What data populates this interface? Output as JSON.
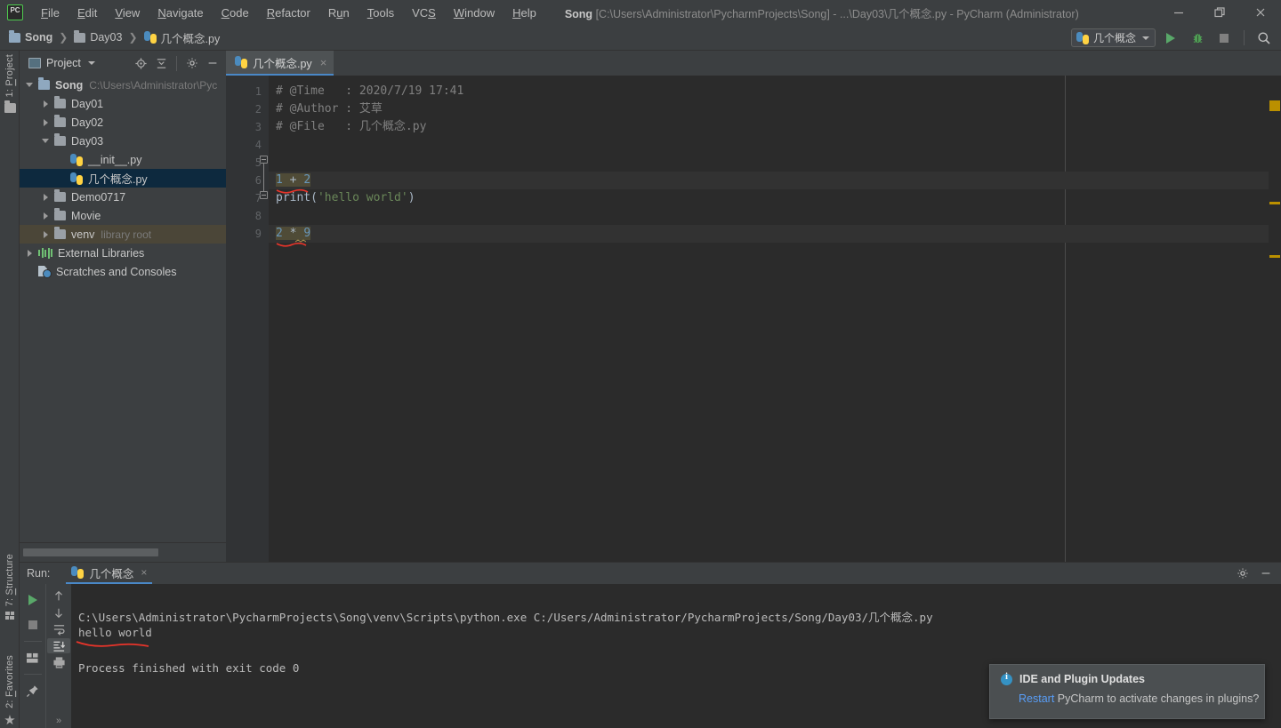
{
  "window": {
    "logo": "pycharm-logo",
    "title_project": "Song",
    "title_rest": "[C:\\Users\\Administrator\\PycharmProjects\\Song] - ...\\Day03\\几个概念.py - PyCharm (Administrator)",
    "minimize": "minimize-icon",
    "maximize": "maximize-icon",
    "close": "close-icon"
  },
  "menu": {
    "items": [
      {
        "pre": "",
        "mn": "F",
        "post": "ile"
      },
      {
        "pre": "",
        "mn": "E",
        "post": "dit"
      },
      {
        "pre": "",
        "mn": "V",
        "post": "iew"
      },
      {
        "pre": "",
        "mn": "N",
        "post": "avigate"
      },
      {
        "pre": "",
        "mn": "C",
        "post": "ode"
      },
      {
        "pre": "",
        "mn": "R",
        "post": "efactor"
      },
      {
        "pre": "R",
        "mn": "u",
        "post": "n"
      },
      {
        "pre": "",
        "mn": "T",
        "post": "ools"
      },
      {
        "pre": "VC",
        "mn": "S",
        "post": ""
      },
      {
        "pre": "",
        "mn": "W",
        "post": "indow"
      },
      {
        "pre": "",
        "mn": "H",
        "post": "elp"
      }
    ]
  },
  "breadcrumb": {
    "items": [
      "Song",
      "Day03",
      "几个概念.py"
    ],
    "separator": "❯"
  },
  "toolbar": {
    "run_config_label": "几个概念",
    "run_button": "run-icon",
    "debug_button": "debug-icon",
    "stop_button": "stop-icon",
    "search_button": "search-icon"
  },
  "left_strip": {
    "project_tab": {
      "num": "1: ",
      "mn": "P",
      "rest": "roject"
    },
    "structure_tab": {
      "num": "7: ",
      "mn": "S",
      "rest": "tructure"
    },
    "favorites_tab": {
      "num": "2: ",
      "mn": "F",
      "rest": "avorites"
    }
  },
  "project_panel": {
    "title": "Project",
    "header_icons": [
      "locate-icon",
      "collapse-all-icon",
      "gear-icon",
      "hide-icon"
    ],
    "tree": [
      {
        "indent": 0,
        "twisty": "down",
        "icon": "folder-blue",
        "label": "Song",
        "bold": true,
        "sub": "C:\\Users\\Administrator\\Pyc",
        "state": "normal"
      },
      {
        "indent": 1,
        "twisty": "right",
        "icon": "folder-dark",
        "label": "Day01",
        "bold": false,
        "sub": "",
        "state": "normal"
      },
      {
        "indent": 1,
        "twisty": "right",
        "icon": "folder-dark",
        "label": "Day02",
        "bold": false,
        "sub": "",
        "state": "normal"
      },
      {
        "indent": 1,
        "twisty": "down",
        "icon": "folder-dark",
        "label": "Day03",
        "bold": false,
        "sub": "",
        "state": "normal"
      },
      {
        "indent": 2,
        "twisty": "none",
        "icon": "python-file",
        "label": "__init__.py",
        "bold": false,
        "sub": "",
        "state": "normal"
      },
      {
        "indent": 2,
        "twisty": "none",
        "icon": "python-file",
        "label": "几个概念.py",
        "bold": false,
        "sub": "",
        "state": "selected"
      },
      {
        "indent": 1,
        "twisty": "right",
        "icon": "folder-dark",
        "label": "Demo0717",
        "bold": false,
        "sub": "",
        "state": "normal"
      },
      {
        "indent": 1,
        "twisty": "right",
        "icon": "folder-dark",
        "label": "Movie",
        "bold": false,
        "sub": "",
        "state": "normal"
      },
      {
        "indent": 1,
        "twisty": "right",
        "icon": "folder-dark",
        "label": "venv",
        "bold": false,
        "sub": "library root",
        "state": "venv"
      },
      {
        "indent": 0,
        "twisty": "right",
        "icon": "libraries",
        "label": "External Libraries",
        "bold": false,
        "sub": "",
        "state": "normal"
      },
      {
        "indent": 0,
        "twisty": "none",
        "icon": "scratches",
        "label": "Scratches and Consoles",
        "bold": false,
        "sub": "",
        "state": "normal"
      }
    ]
  },
  "editor": {
    "tab": {
      "label": "几个概念.py",
      "icon": "python-file",
      "close": "×"
    },
    "lines": [
      {
        "n": "1",
        "tokens": [
          {
            "t": "# @Time   : 2020/7/19 17:41",
            "c": "cmt"
          }
        ]
      },
      {
        "n": "2",
        "tokens": [
          {
            "t": "# @Author : 艾草",
            "c": "cmt"
          }
        ]
      },
      {
        "n": "3",
        "tokens": [
          {
            "t": "# @File   : 几个概念.py",
            "c": "cmt"
          }
        ]
      },
      {
        "n": "4",
        "tokens": []
      },
      {
        "n": "5",
        "tokens": []
      },
      {
        "n": "6",
        "tokens": [
          {
            "t": "1",
            "c": "num hl"
          },
          {
            "t": " + ",
            "c": "op hl"
          },
          {
            "t": "2",
            "c": "num hl"
          }
        ]
      },
      {
        "n": "7",
        "tokens": [
          {
            "t": "print",
            "c": "fn"
          },
          {
            "t": "(",
            "c": "pun"
          },
          {
            "t": "'hello world'",
            "c": "str"
          },
          {
            "t": ")",
            "c": "pun"
          }
        ]
      },
      {
        "n": "8",
        "tokens": []
      },
      {
        "n": "9",
        "tokens": [
          {
            "t": "2",
            "c": "num hl"
          },
          {
            "t": " * ",
            "c": "op hl"
          },
          {
            "t": "9",
            "c": "num hl"
          }
        ]
      }
    ],
    "markers": [
      "warning-box",
      "warning-bar",
      "warning-bar"
    ]
  },
  "run_panel": {
    "label": "Run:",
    "tab_name": "几个概念",
    "tab_close": "×",
    "header_icons": [
      "gear-icon",
      "hide-icon"
    ],
    "tool_icons": [
      "rerun-icon",
      "stop-icon",
      "layout-icon",
      "pin-icon",
      "scroll-up-icon",
      "scroll-down-icon",
      "soft-wrap-icon",
      "scroll-to-end-icon",
      "print-icon",
      "more-icon"
    ],
    "console": {
      "command": "C:\\Users\\Administrator\\PycharmProjects\\Song\\venv\\Scripts\\python.exe C:/Users/Administrator/PycharmProjects/Song/Day03/几个概念.py",
      "output": "hello world",
      "status": "Process finished with exit code 0"
    }
  },
  "notification": {
    "icon": "info-icon",
    "title": "IDE and Plugin Updates",
    "link": "Restart",
    "body": " PyCharm to activate changes in plugins?"
  },
  "colors": {
    "bg_chrome": "#3c3f41",
    "bg_editor": "#2b2b2b",
    "accent_blue": "#4a88c7",
    "selection": "#0d293e",
    "venv_row": "#4b4638",
    "run_green": "#59a869",
    "warning": "#bb9000",
    "link": "#589df6",
    "string_green": "#6a8759",
    "number_blue": "#6897bb",
    "comment_grey": "#808080",
    "highlight_bg": "#4f4b37",
    "error_red": "#e74c3c"
  }
}
